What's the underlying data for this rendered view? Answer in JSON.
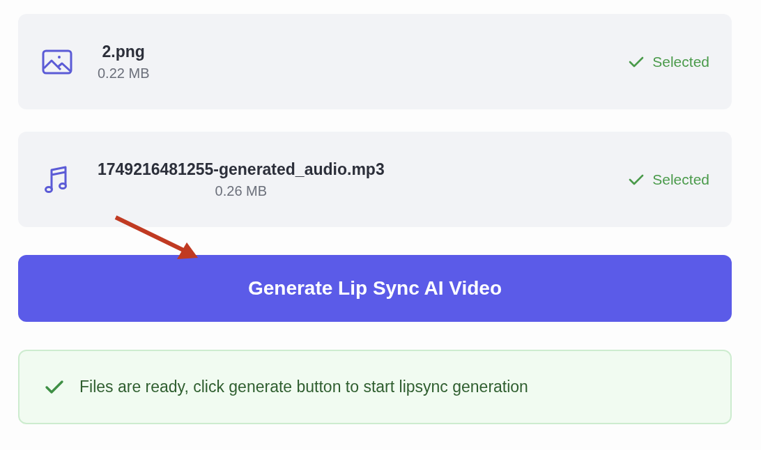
{
  "files": [
    {
      "kind": "image",
      "name": "2.png",
      "size": "0.22 MB",
      "selected": true,
      "status": "Selected"
    },
    {
      "kind": "audio",
      "name": "1749216481255-generated_audio.mp3",
      "size": "0.26 MB",
      "selected": true,
      "status": "Selected"
    }
  ],
  "generate_button": {
    "label": "Generate Lip Sync AI Video"
  },
  "notice": {
    "text": "Files are ready, click generate button to start lipsync generation"
  }
}
